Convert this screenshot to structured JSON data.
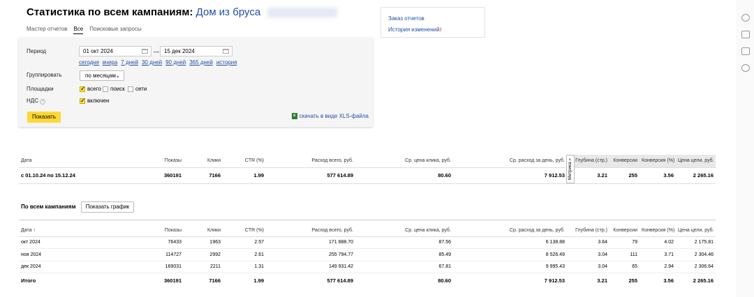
{
  "header": {
    "title": "Статистика по всем кампаниям:",
    "campaign_name": "Дом из бруса"
  },
  "tabs": [
    "Мастер отчетов",
    "Все",
    "Поисковые запросы"
  ],
  "report_links": {
    "order": "Заказ отчетов",
    "history": "История изменений",
    "history_badge": "β"
  },
  "filters": {
    "period_label": "Период",
    "date_from": "01 окт 2024",
    "date_to": "15 дек 2024",
    "dash": "—",
    "quick": [
      "сегодня",
      "вчера",
      "7 дней",
      "30 дней",
      "90 дней",
      "365 дней",
      "история"
    ],
    "group_label": "Группировать",
    "group_value": "по месяцам",
    "platforms_label": "Площадки",
    "platforms": [
      {
        "label": "всего",
        "checked": true
      },
      {
        "label": "поиск",
        "checked": false
      },
      {
        "label": "сети",
        "checked": false
      }
    ],
    "vat_label": "НДС",
    "vat_option": "включен",
    "show_button": "Показать",
    "xls_link": "скачать в виде XLS-файла"
  },
  "columns": [
    "Дата",
    "Показы",
    "Клики",
    "CTR (%)",
    "Расход всего, руб.",
    "Ср. цена клика, руб.",
    "Ср. расход за день, руб.",
    "Глубина (стр.)",
    "Конверсии",
    "Конверсия (%)",
    "Цена цели, руб."
  ],
  "metrika_label": "Метрика »",
  "summary": {
    "row": [
      "с 01.10.24 по 15.12.24",
      "360191",
      "7166",
      "1.99",
      "577 614.89",
      "80.60",
      "7 912.53",
      "3.21",
      "255",
      "3.56",
      "2 265.16"
    ]
  },
  "detail": {
    "section_title": "По всем кампаниям",
    "graph_button": "Показать график",
    "date_col_label": "Дата ↑",
    "rows": [
      [
        "окт 2024",
        "76433",
        "1963",
        "2.57",
        "171 888.70",
        "87.56",
        "6 138.88",
        "3.64",
        "79",
        "4.02",
        "2 175.81"
      ],
      [
        "ноя 2024",
        "114727",
        "2992",
        "2.61",
        "255 794.77",
        "85.49",
        "8 526.49",
        "3.04",
        "111",
        "3.71",
        "2 304.46"
      ],
      [
        "дек 2024",
        "169031",
        "2211",
        "1.31",
        "149 931.42",
        "67.81",
        "9 995.43",
        "3.04",
        "65",
        "2.94",
        "2 306.64"
      ]
    ],
    "total": [
      "Итого",
      "360191",
      "7166",
      "1.99",
      "577 614.89",
      "80.60",
      "7 912.53",
      "3.21",
      "255",
      "3.56",
      "2 265.16"
    ]
  }
}
